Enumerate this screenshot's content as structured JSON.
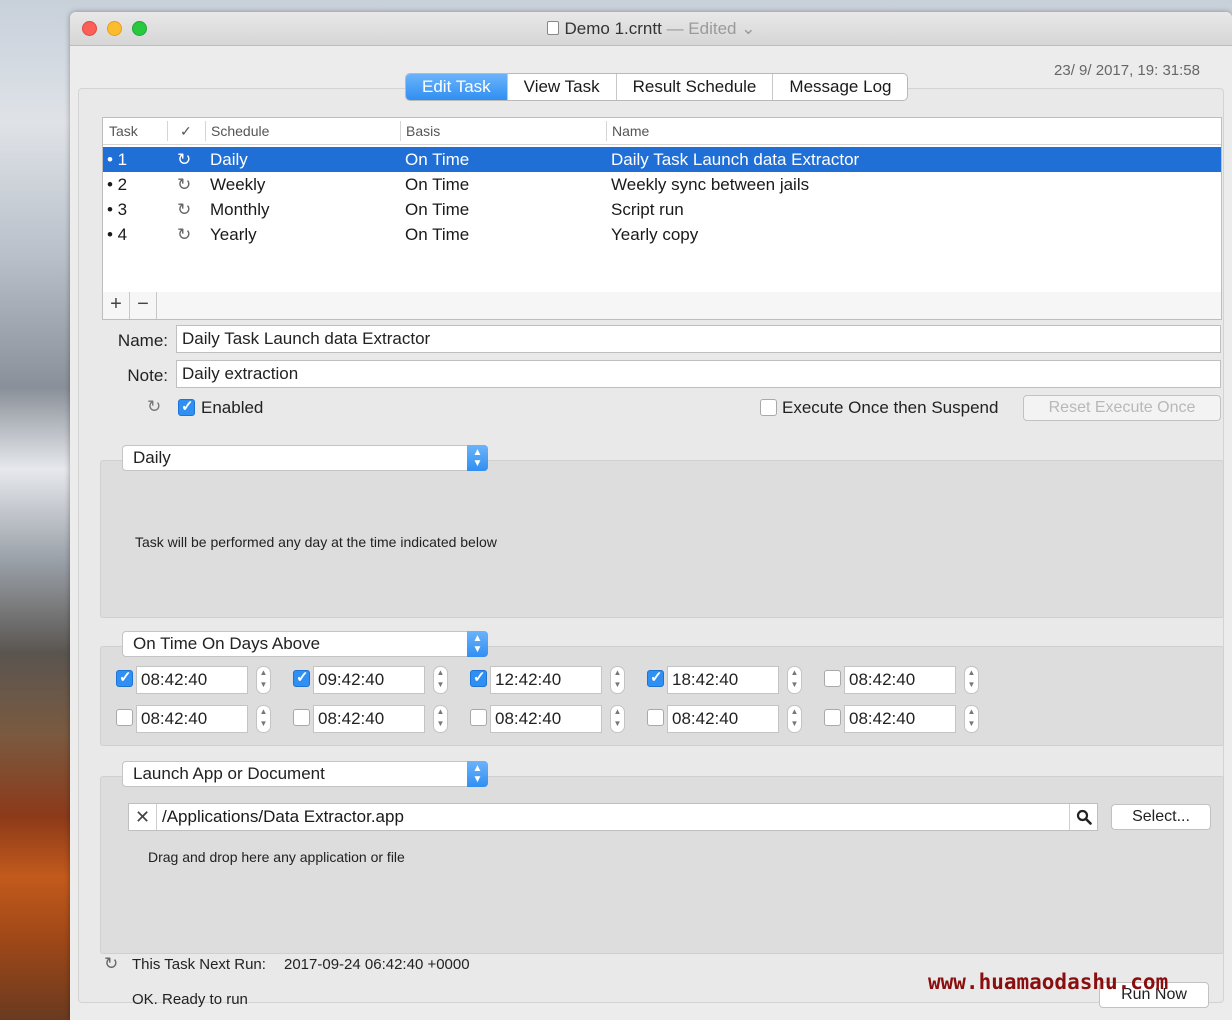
{
  "window": {
    "title": "Demo 1.crntt",
    "edited": "— Edited ⌄",
    "timestamp": "23/ 9/ 2017, 19: 31:58"
  },
  "tabs": [
    {
      "label": "Edit Task",
      "active": true
    },
    {
      "label": "View Task"
    },
    {
      "label": "Result Schedule"
    },
    {
      "label": "Message Log"
    }
  ],
  "table": {
    "headers": {
      "task": "Task",
      "check": "✓",
      "schedule": "Schedule",
      "basis": "Basis",
      "name": "Name"
    },
    "rows": [
      {
        "task": "• 1",
        "schedule": "Daily",
        "basis": "On Time",
        "name": "Daily Task Launch data Extractor",
        "selected": true
      },
      {
        "task": "• 2",
        "schedule": "Weekly",
        "basis": "On Time",
        "name": "Weekly sync between jails"
      },
      {
        "task": "• 3",
        "schedule": "Monthly",
        "basis": "On Time",
        "name": "Script run"
      },
      {
        "task": "• 4",
        "schedule": "Yearly",
        "basis": "On Time",
        "name": "Yearly copy"
      }
    ],
    "add_label": "+",
    "remove_label": "−"
  },
  "form": {
    "name_label": "Name:",
    "name_value": "Daily Task Launch data Extractor",
    "note_label": "Note:",
    "note_value": "Daily extraction",
    "enabled_label": "Enabled",
    "enabled": true,
    "execute_once_label": "Execute Once then Suspend",
    "execute_once": false,
    "reset_label": "Reset Execute Once"
  },
  "schedule": {
    "selected": "Daily",
    "description": "Task will be performed any day at the time indicated below"
  },
  "times": {
    "selected": "On Time On Days Above",
    "rows": [
      [
        {
          "value": "08:42:40",
          "checked": true
        },
        {
          "value": "09:42:40",
          "checked": true
        },
        {
          "value": "12:42:40",
          "checked": true
        },
        {
          "value": "18:42:40",
          "checked": true
        },
        {
          "value": "08:42:40",
          "checked": false
        }
      ],
      [
        {
          "value": "08:42:40",
          "checked": false
        },
        {
          "value": "08:42:40",
          "checked": false
        },
        {
          "value": "08:42:40",
          "checked": false
        },
        {
          "value": "08:42:40",
          "checked": false
        },
        {
          "value": "08:42:40",
          "checked": false
        }
      ]
    ]
  },
  "action": {
    "selected": "Launch App or Document",
    "path": "/Applications/Data Extractor.app",
    "select_label": "Select...",
    "hint": "Drag and drop here any application or file"
  },
  "footer": {
    "next_run_label": "This Task Next Run:",
    "next_run_value": "2017-09-24 06:42:40 +0000",
    "status": "OK. Ready to run",
    "run_now_label": "Run Now"
  },
  "watermark": "www.huamaodashu.com",
  "colors": {
    "accent": "#2f8ff2",
    "selection": "#1f6fd6",
    "watermark": "#8a0e0e"
  }
}
